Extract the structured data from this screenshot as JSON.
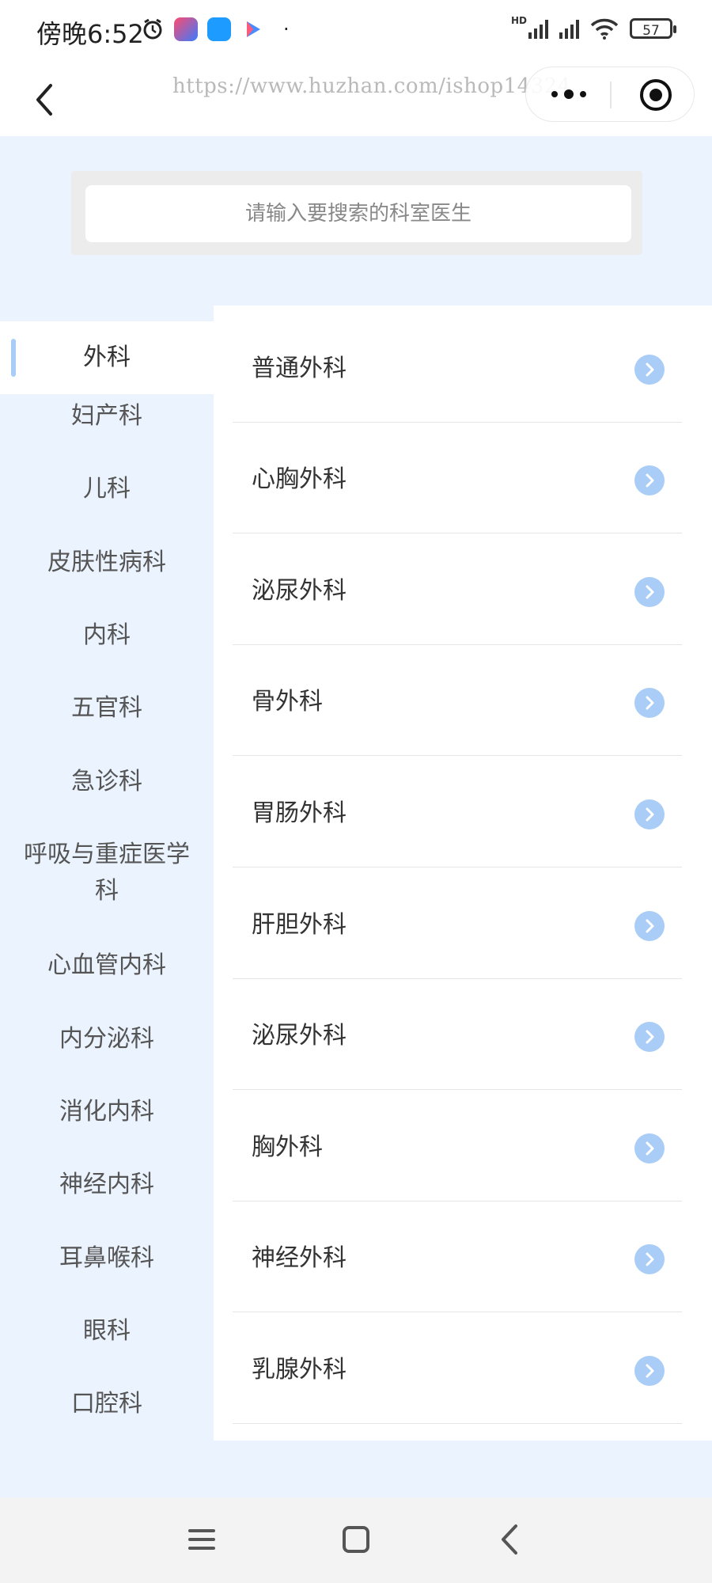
{
  "status_bar": {
    "time": "傍晚6:52",
    "battery": "57",
    "network": "HD"
  },
  "nav": {
    "url": "https://www.huzhan.com/ishop14324"
  },
  "search": {
    "placeholder": "请输入要搜索的科室医生"
  },
  "sidebar": {
    "items": [
      {
        "label": "外科",
        "active": true
      },
      {
        "label": "妇产科"
      },
      {
        "label": "儿科"
      },
      {
        "label": "皮肤性病科"
      },
      {
        "label": "内科"
      },
      {
        "label": "五官科"
      },
      {
        "label": "急诊科"
      },
      {
        "label": "呼吸与重症医学科"
      },
      {
        "label": "心血管内科"
      },
      {
        "label": "内分泌科"
      },
      {
        "label": "消化内科"
      },
      {
        "label": "神经内科"
      },
      {
        "label": "耳鼻喉科"
      },
      {
        "label": "眼科"
      },
      {
        "label": "口腔科"
      }
    ]
  },
  "departments": {
    "items": [
      {
        "label": "普通外科"
      },
      {
        "label": "心胸外科"
      },
      {
        "label": "泌尿外科"
      },
      {
        "label": "骨外科"
      },
      {
        "label": "胃肠外科"
      },
      {
        "label": "肝胆外科"
      },
      {
        "label": "泌尿外科"
      },
      {
        "label": "胸外科"
      },
      {
        "label": "神经外科"
      },
      {
        "label": "乳腺外科"
      }
    ]
  },
  "colors": {
    "accent": "#a9cdf7",
    "background": "#ebf3ff"
  }
}
